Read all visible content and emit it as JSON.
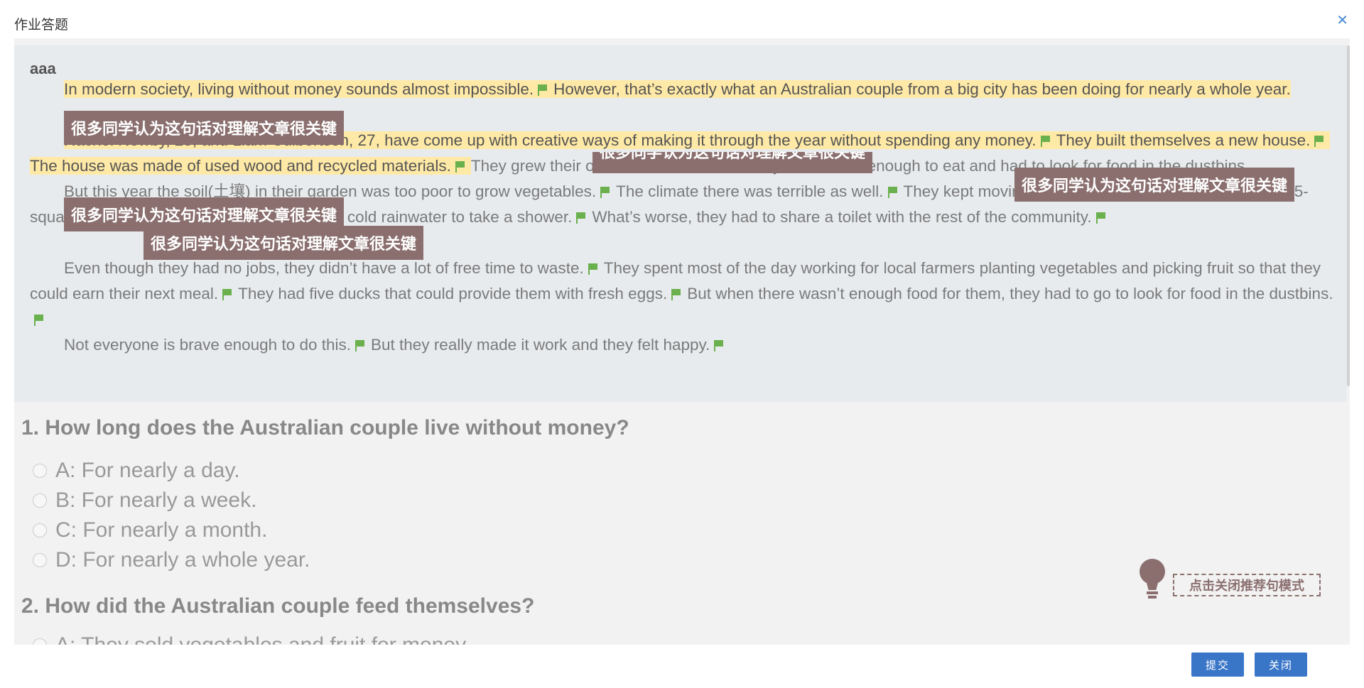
{
  "window": {
    "title": "作业答题",
    "close_icon": "close-icon"
  },
  "passage": {
    "title": "aaa",
    "p1": {
      "s1": "In modern society, living without money sounds almost impossible.",
      "s2": "However, that’s exactly what an Australian couple from a big city has been doing for nearly a whole year."
    },
    "p2": {
      "s1": "Rachel Newby, 25, and Liam Culbertson, 27, have come up with creative ways of making it through the year without spending any money.",
      "s2": "They built themselves a new house.",
      "s3": "The house was made of used wood and recycled materials.",
      "s4": "They grew their own food, and at times they didn’t have enough to eat and had to look for food in the dustbins."
    },
    "p3": {
      "s1": "But this year the soil(土壤) in their garden was too poor to grow vegetables.",
      "s2": "The climate there was terrible as well.",
      "s3": "They kept moving their home till they finally lived in a 2.5-square(平方)-meter house.",
      "s4": "They collected cold rainwater to take a shower.",
      "s5": "What’s worse, they had to share a toilet with the rest of the community."
    },
    "p4": {
      "s1": "Even though they had no jobs, they didn’t have a lot of free time to waste.",
      "s2": "They spent most of the day working for local farmers planting vegetables and picking fruit so that they could earn their next meal.",
      "s3": "They had five ducks that could provide them with fresh eggs.",
      "s4": "But when there wasn’t enough food for them, they had to go to look for food in the dustbins."
    },
    "p5": {
      "s1": "Not everyone is brave enough to do this.",
      "s2": "But they really made it work and they felt happy."
    },
    "tag_text": "很多同学认为这句话对理解文章很关键"
  },
  "questions": [
    {
      "text": "1. How long does the Australian couple live without money?",
      "options": [
        "A: For nearly a day.",
        "B: For nearly a week.",
        "C: For nearly a month.",
        "D: For nearly a whole year."
      ]
    },
    {
      "text": "2. How did the Australian couple feed themselves?",
      "options": [
        "A: They sold vegetables and fruit for money."
      ]
    }
  ],
  "recommend_mode_label": "点击关闭推荐句模式",
  "buttons": {
    "submit": "提交",
    "close": "关闭"
  },
  "colors": {
    "highlight": "#ffe9a6",
    "tag_bg": "#8b6f6f",
    "flag": "#6ab04c",
    "primary": "#3a76c8"
  }
}
